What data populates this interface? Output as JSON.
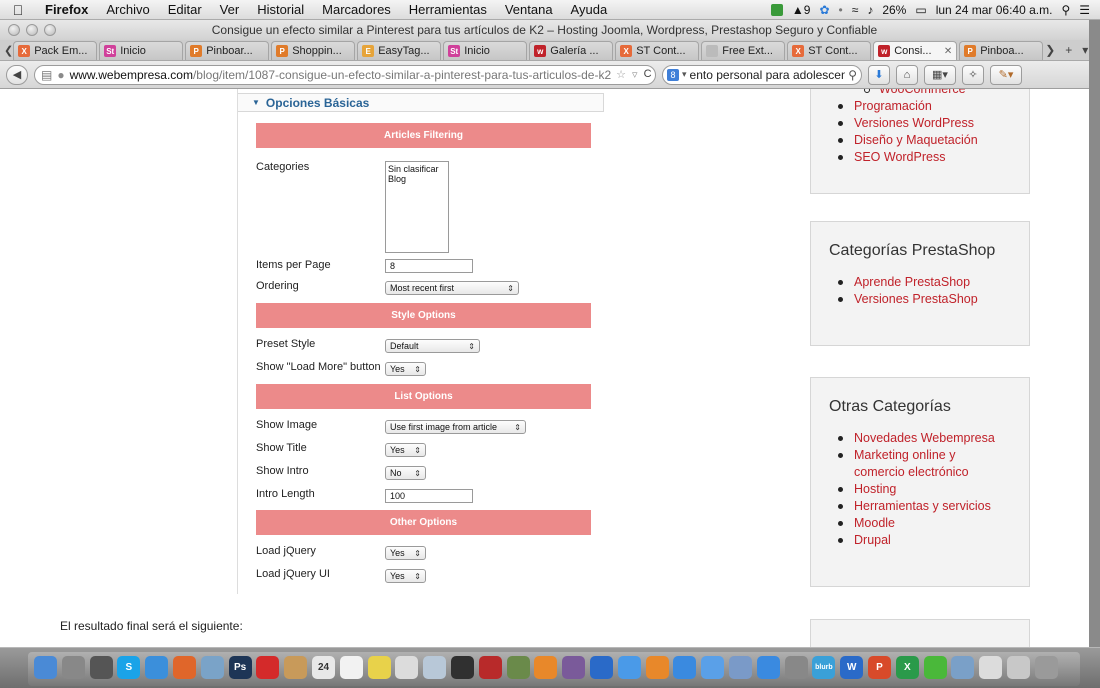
{
  "menubar": {
    "app": "Firefox",
    "menus": [
      "Archivo",
      "Editar",
      "Ver",
      "Historial",
      "Marcadores",
      "Herramientas",
      "Ventana",
      "Ayuda"
    ],
    "status_count": "9",
    "battery": "26%",
    "datetime": "lun 24 mar  06:40 a.m."
  },
  "window": {
    "title": "Consigue un efecto similar a Pinterest para tus artículos de K2 – Hosting Joomla, Wordpress, Prestashop Seguro y Confiable"
  },
  "tabs": [
    {
      "label": "Pack Em...",
      "color": "#e66a3a",
      "glyph": "X"
    },
    {
      "label": "Inicio",
      "color": "#d0409a",
      "glyph": "St"
    },
    {
      "label": "Pinboar...",
      "color": "#e07b2a",
      "glyph": "P"
    },
    {
      "label": "Shoppin...",
      "color": "#e07b2a",
      "glyph": "P"
    },
    {
      "label": "EasyTag...",
      "color": "#e6a43a",
      "glyph": "E"
    },
    {
      "label": "Inicio",
      "color": "#d0409a",
      "glyph": "St"
    },
    {
      "label": "Galería ...",
      "color": "#c0222a",
      "glyph": "w"
    },
    {
      "label": "ST Cont...",
      "color": "#e66a3a",
      "glyph": "X"
    },
    {
      "label": "Free Ext...",
      "color": "#bbbbbb",
      "glyph": ""
    },
    {
      "label": "ST Cont...",
      "color": "#e66a3a",
      "glyph": "X"
    },
    {
      "label": "Consi...",
      "color": "#c0222a",
      "glyph": "w",
      "active": true
    },
    {
      "label": "Pinboa...",
      "color": "#e07b2a",
      "glyph": "P"
    }
  ],
  "nav": {
    "url_domain": "www.webempresa.com",
    "url_path": "/blog/item/1087-consigue-un-efecto-similar-a-pinterest-para-tus-articulos-de-k2",
    "search_value": "ento personal para adolescentes"
  },
  "panel": {
    "header": "Opciones Básicas",
    "sections": {
      "articles_filtering": "Articles Filtering",
      "style_options": "Style Options",
      "list_options": "List Options",
      "other_options": "Other Options"
    },
    "fields": {
      "categories_label": "Categories",
      "categories_options": [
        "Sin clasificar",
        "Blog"
      ],
      "items_per_page_label": "Items per Page",
      "items_per_page_value": "8",
      "ordering_label": "Ordering",
      "ordering_value": "Most recent first",
      "preset_style_label": "Preset Style",
      "preset_style_value": "Default",
      "show_load_more_label": "Show \"Load More\" button",
      "show_load_more_value": "Yes",
      "show_image_label": "Show Image",
      "show_image_value": "Use first image from article",
      "show_title_label": "Show Title",
      "show_title_value": "Yes",
      "show_intro_label": "Show Intro",
      "show_intro_value": "No",
      "intro_length_label": "Intro Length",
      "intro_length_value": "100",
      "load_jquery_label": "Load jQuery",
      "load_jquery_value": "Yes",
      "load_jquery_ui_label": "Load jQuery UI",
      "load_jquery_ui_value": "Yes"
    }
  },
  "final_text": "El resultado final será el siguiente:",
  "sidebar": {
    "box1_items": [
      "WooCommerce",
      "Programación",
      "Versiones WordPress",
      "Diseño y Maquetación",
      "SEO WordPress"
    ],
    "box2_title": "Categorías PrestaShop",
    "box2_items": [
      "Aprende PrestaShop",
      "Versiones PrestaShop"
    ],
    "box3_title": "Otras Categorías",
    "box3_items": [
      "Novedades Webempresa",
      "Marketing online y comercio electrónico",
      "Hosting",
      "Herramientas y servicios",
      "Moodle",
      "Drupal"
    ]
  },
  "dock": {
    "icons": [
      {
        "name": "finder-icon",
        "color": "#4a8ad6",
        "glyph": ""
      },
      {
        "name": "launchpad-icon",
        "color": "#888888",
        "glyph": ""
      },
      {
        "name": "mission-control-icon",
        "color": "#555555",
        "glyph": ""
      },
      {
        "name": "skype-icon",
        "color": "#1aa3e8",
        "glyph": "S"
      },
      {
        "name": "safari-icon",
        "color": "#3b8fdb",
        "glyph": ""
      },
      {
        "name": "firefox-icon",
        "color": "#e0662a",
        "glyph": ""
      },
      {
        "name": "preview-icon",
        "color": "#7aa3c8",
        "glyph": ""
      },
      {
        "name": "photoshop-icon",
        "color": "#1d3556",
        "glyph": "Ps"
      },
      {
        "name": "acrobat-icon",
        "color": "#d42a2a",
        "glyph": ""
      },
      {
        "name": "contacts-icon",
        "color": "#c89a5a",
        "glyph": ""
      },
      {
        "name": "calendar-icon",
        "color": "#e8e8e8",
        "glyph": "24"
      },
      {
        "name": "reminders-icon",
        "color": "#f2f2f2",
        "glyph": ""
      },
      {
        "name": "notes-icon",
        "color": "#e8d24a",
        "glyph": ""
      },
      {
        "name": "textedit-icon",
        "color": "#dcdcdc",
        "glyph": ""
      },
      {
        "name": "preview2-icon",
        "color": "#b8c8d8",
        "glyph": ""
      },
      {
        "name": "quicktime-icon",
        "color": "#303030",
        "glyph": ""
      },
      {
        "name": "photobooth-icon",
        "color": "#b82a2a",
        "glyph": ""
      },
      {
        "name": "photo-icon",
        "color": "#6a8a4a",
        "glyph": ""
      },
      {
        "name": "vlc-icon",
        "color": "#e8882a",
        "glyph": ""
      },
      {
        "name": "imovie-icon",
        "color": "#7a5a9a",
        "glyph": ""
      },
      {
        "name": "quicktime-x-icon",
        "color": "#2a6ac8",
        "glyph": ""
      },
      {
        "name": "itunes-icon",
        "color": "#4a9ae8",
        "glyph": ""
      },
      {
        "name": "ibooks-icon",
        "color": "#e8882a",
        "glyph": ""
      },
      {
        "name": "app-store-icon",
        "color": "#3a8ae0",
        "glyph": ""
      },
      {
        "name": "sync-icon",
        "color": "#5aa0e8",
        "glyph": ""
      },
      {
        "name": "eye-icon",
        "color": "#7a9ac8",
        "glyph": ""
      },
      {
        "name": "downloader-icon",
        "color": "#3a8ae0",
        "glyph": ""
      },
      {
        "name": "system-prefs-icon",
        "color": "#888888",
        "glyph": ""
      },
      {
        "name": "blurb-icon",
        "color": "#3aa0d8",
        "glyph": "blurb"
      },
      {
        "name": "word-icon",
        "color": "#2a6ac8",
        "glyph": "W"
      },
      {
        "name": "powerpoint-icon",
        "color": "#d84a2a",
        "glyph": "P"
      },
      {
        "name": "excel-icon",
        "color": "#2a9a4a",
        "glyph": "X"
      },
      {
        "name": "media-icon",
        "color": "#4ab83a",
        "glyph": ""
      },
      {
        "name": "bluetooth-icon",
        "color": "#7aa0c8",
        "glyph": ""
      },
      {
        "name": "documents-icon",
        "color": "#dcdcdc",
        "glyph": ""
      },
      {
        "name": "downloads-icon",
        "color": "#c8c8c8",
        "glyph": ""
      },
      {
        "name": "trash-icon",
        "color": "#9a9a9a",
        "glyph": ""
      }
    ]
  }
}
